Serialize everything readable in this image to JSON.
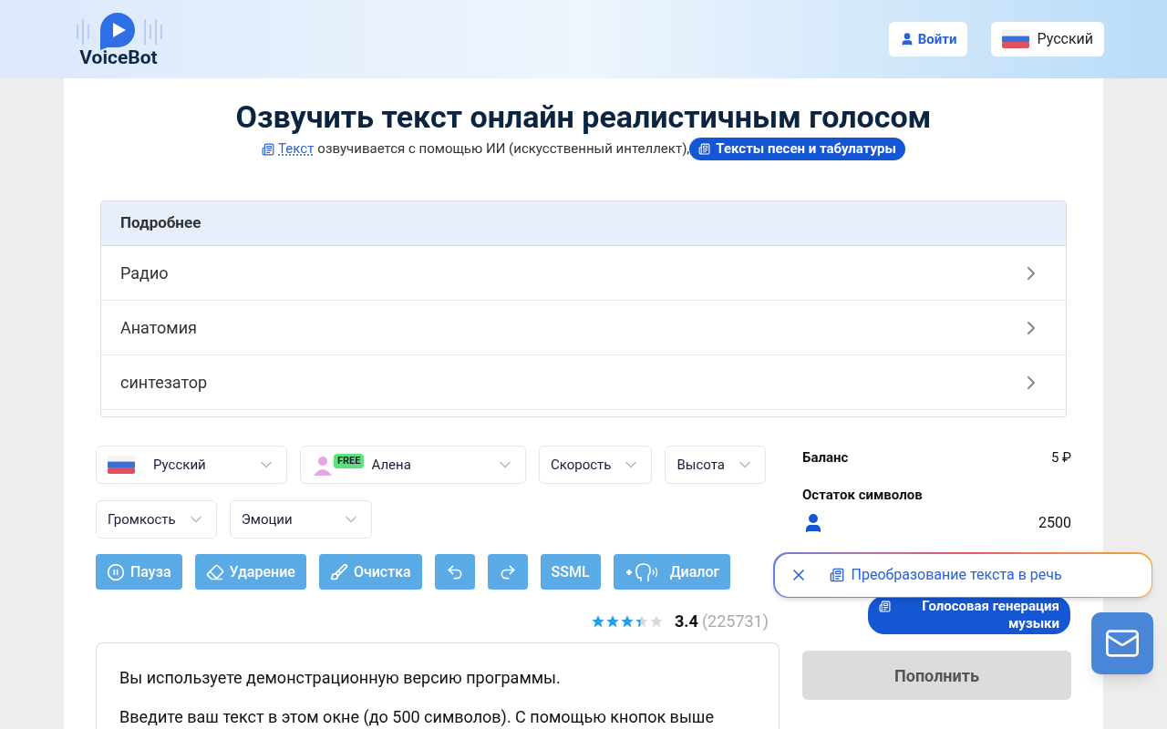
{
  "header": {
    "logo": "VoiceBot",
    "login_button": "Войти",
    "language_button": "Русский"
  },
  "title": "Озвучить текст онлайн реалистичным голосом",
  "subtitle": {
    "link": "Текст",
    "text": "озвучивается с помощью ИИ (искусственный интеллект),",
    "badge": "Тексты песен и табулатуры"
  },
  "accordion": {
    "header": "Подробнее",
    "items": [
      {
        "label": "Радио",
        "expanded": false
      },
      {
        "label": "Анатомия",
        "expanded": false
      },
      {
        "label": "синтезатор",
        "expanded": false
      }
    ]
  },
  "selects": [
    {
      "kind": "language",
      "label": "Русский"
    },
    {
      "kind": "voice",
      "label": "Алена",
      "badge": "FREE"
    },
    {
      "kind": "plain",
      "label": "Скорость"
    },
    {
      "kind": "plain",
      "label": "Высота"
    },
    {
      "kind": "plain",
      "label": "Громкость"
    },
    {
      "kind": "wide",
      "label": "Эмоции"
    }
  ],
  "tools": [
    {
      "kind": "pause",
      "label": "Пауза"
    },
    {
      "kind": "stress",
      "label": "Ударение"
    },
    {
      "kind": "clear",
      "label": "Очистка"
    },
    {
      "kind": "undo"
    },
    {
      "kind": "redo"
    },
    {
      "kind": "text",
      "label": "SSML"
    },
    {
      "kind": "dialog",
      "label": "Диалог"
    }
  ],
  "rating": {
    "stars": 3.4,
    "value": "3.4",
    "count": "(225731)"
  },
  "editor": {
    "lines": [
      "Вы используете демонстрационную версию программы.",
      "Введите ваш текст в этом окне (до 500 символов). С помощью кнопок выше"
    ]
  },
  "balance": {
    "label": "Баланс",
    "value": "5 ₽",
    "chars_label": "Остаток символов",
    "chars": [
      {
        "value": "2500"
      }
    ]
  },
  "music_badge": "Голосовая генерация музыки",
  "topup_button": "Пополнить",
  "toast": {
    "text": "Преобразование текста в речь"
  }
}
